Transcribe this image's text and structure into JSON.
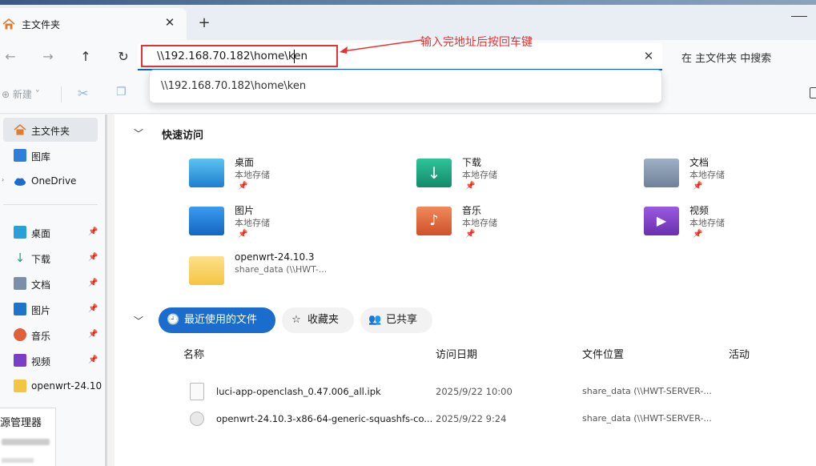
{
  "tab": {
    "title": "主文件夹",
    "close": "✕",
    "new": "+"
  },
  "address": {
    "value": "\\\\192.168.70.182\\home\\ken",
    "clear": "✕",
    "search_placeholder": "在 主文件夹 中搜索",
    "suggestion": "\\\\192.168.70.182\\home\\ken",
    "annotation": "输入完地址后按回车键"
  },
  "toolbar": {
    "new_label": "新建"
  },
  "sidebar": {
    "items": [
      {
        "label": "主文件夹",
        "icon": "home-icon"
      },
      {
        "label": "图库",
        "icon": "gallery-icon"
      },
      {
        "label": "OneDrive",
        "icon": "cloud-icon"
      },
      {
        "label": "桌面",
        "icon": "desktop-icon"
      },
      {
        "label": "下载",
        "icon": "download-icon"
      },
      {
        "label": "文档",
        "icon": "document-icon"
      },
      {
        "label": "图片",
        "icon": "picture-icon"
      },
      {
        "label": "音乐",
        "icon": "music-icon"
      },
      {
        "label": "视频",
        "icon": "video-icon"
      },
      {
        "label": "openwrt-24.10",
        "icon": "folder-icon"
      }
    ],
    "popup_label": "源管理器"
  },
  "quick_access": {
    "title": "快速访问",
    "items": [
      {
        "name": "桌面",
        "sub": "本地存储"
      },
      {
        "name": "下载",
        "sub": "本地存储"
      },
      {
        "name": "文档",
        "sub": "本地存储"
      },
      {
        "name": "图片",
        "sub": "本地存储"
      },
      {
        "name": "音乐",
        "sub": "本地存储"
      },
      {
        "name": "视频",
        "sub": "本地存储"
      },
      {
        "name": "openwrt-24.10.3",
        "sub": "share_data (\\\\HWT-..."
      }
    ]
  },
  "recent": {
    "tabs": [
      "最近使用的文件",
      "收藏夹",
      "已共享"
    ],
    "columns": [
      "名称",
      "访问日期",
      "文件位置",
      "活动"
    ],
    "rows": [
      {
        "name": "luci-app-openclash_0.47.006_all.ipk",
        "date": "2025/9/22 10:00",
        "location": "share_data (\\\\HWT-SERVER-..."
      },
      {
        "name": "openwrt-24.10.3-x86-64-generic-squashfs-co...",
        "date": "2025/9/22 9:24",
        "location": "share_data (\\\\HWT-SERVER-..."
      }
    ]
  },
  "colors": {
    "accent": "#1a6ccd",
    "annotation": "#e53333"
  }
}
